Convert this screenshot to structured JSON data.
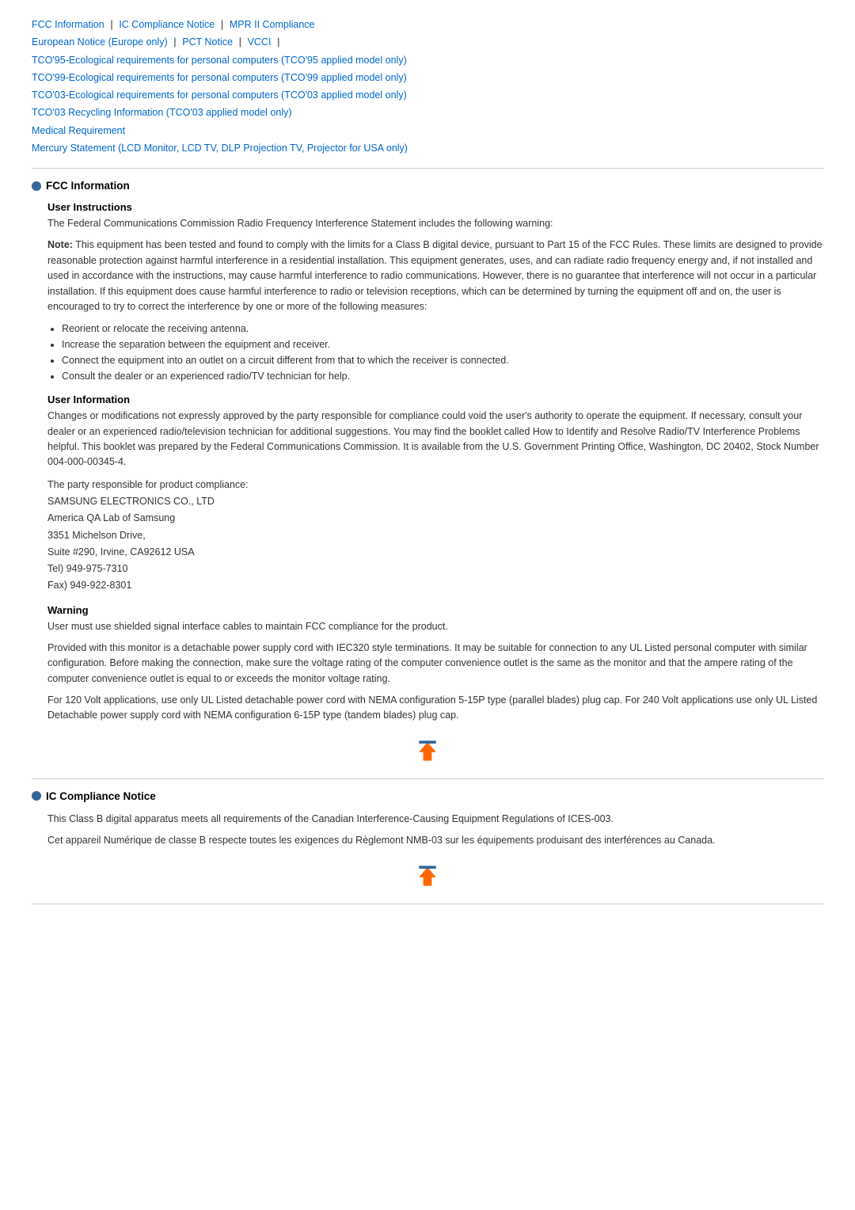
{
  "nav": {
    "links": [
      {
        "label": "FCC Information",
        "id": "fcc"
      },
      {
        "label": "IC Compliance Notice",
        "id": "ic"
      },
      {
        "label": "MPR II Compliance",
        "id": "mpr"
      },
      {
        "label": "European Notice (Europe only)",
        "id": "european"
      },
      {
        "label": "PCT Notice",
        "id": "pct"
      },
      {
        "label": "VCCI",
        "id": "vcci"
      },
      {
        "label": "TCO'95-Ecological requirements for personal computers (TCO'95 applied model only)",
        "id": "tco95"
      },
      {
        "label": "TCO'99-Ecological requirements for personal computers (TCO'99 applied model only)",
        "id": "tco99"
      },
      {
        "label": "TCO'03-Ecological requirements for personal computers (TCO'03 applied model only)",
        "id": "tco03"
      },
      {
        "label": "TCO'03 Recycling Information (TCO'03 applied model only)",
        "id": "tco03r"
      },
      {
        "label": "Medical Requirement",
        "id": "medical"
      },
      {
        "label": "Mercury Statement (LCD Monitor, LCD TV, DLP Projection TV, Projector for USA only)",
        "id": "mercury"
      }
    ]
  },
  "sections": {
    "fcc": {
      "title": "FCC Information",
      "user_instructions": {
        "subtitle": "User Instructions",
        "para1": "The Federal Communications Commission Radio Frequency Interference Statement includes the following warning:",
        "note_prefix": "Note:",
        "note_body": " This equipment has been tested and found to comply with the limits for a Class B digital device, pursuant to Part 15 of the FCC Rules. These limits are designed to provide reasonable protection against harmful interference in a residential installation. This equipment generates, uses, and can radiate radio frequency energy and, if not installed and used in accordance with the instructions, may cause harmful interference to radio communications. However, there is no guarantee that interference will not occur in a particular installation. If this equipment does cause harmful interference to radio or television receptions, which can be determined by turning the equipment off and on, the user is encouraged to try to correct the interference by one or more of the following measures:",
        "bullets": [
          "Reorient or relocate the receiving antenna.",
          "Increase the separation between the equipment and receiver.",
          "Connect the equipment into an outlet on a circuit different from that to which the receiver is connected.",
          "Consult the dealer or an experienced radio/TV technician for help."
        ]
      },
      "user_information": {
        "subtitle": "User Information",
        "para1": "Changes or modifications not expressly approved by the party responsible for compliance could void the user's authority to operate the equipment. If necessary, consult your dealer or an experienced radio/television technician for additional suggestions. You may find the booklet called How to Identify and Resolve Radio/TV Interference Problems helpful. This booklet was prepared by the Federal Communications Commission. It is available from the U.S. Government Printing Office, Washington, DC 20402, Stock Number 004-000-00345-4.",
        "party_label": "The party responsible for product compliance:",
        "company_lines": [
          "SAMSUNG ELECTRONICS CO., LTD",
          "America QA Lab of Samsung",
          "3351 Michelson Drive,",
          "Suite #290, Irvine, CA92612 USA",
          "Tel) 949-975-7310",
          "Fax) 949-922-8301"
        ]
      },
      "warning": {
        "subtitle": "Warning",
        "para1": "User must use shielded signal interface cables to maintain FCC compliance for the product.",
        "para2": "Provided with this monitor is a detachable power supply cord with IEC320 style terminations. It may be suitable for connection to any UL Listed personal computer with similar configuration. Before making the connection, make sure the voltage rating of the computer convenience outlet is the same as the monitor and that the ampere rating of the computer convenience outlet is equal to or exceeds the monitor voltage rating.",
        "para3": "For 120 Volt applications, use only UL Listed detachable power cord with NEMA configuration 5-15P type (parallel blades) plug cap. For 240 Volt applications use only UL Listed Detachable power supply cord with NEMA configuration 6-15P type (tandem blades) plug cap."
      }
    },
    "ic": {
      "title": "IC Compliance Notice",
      "para1": "This Class B digital apparatus meets all requirements of the Canadian Interference-Causing Equipment Regulations of ICES-003.",
      "para2": "Cet appareil Numérique de classe B respecte toutes les exigences du Règlemont NMB-03 sur les équipements produisant des interférences au Canada."
    }
  },
  "top_button_label": "Top"
}
